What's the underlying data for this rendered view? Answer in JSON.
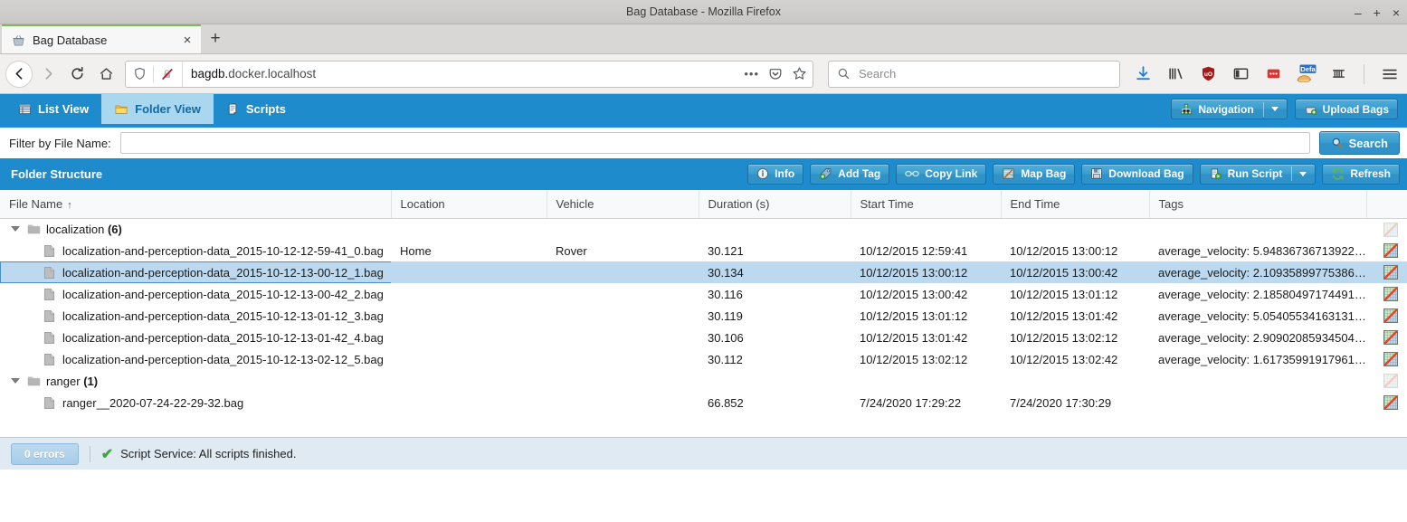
{
  "window": {
    "title": "Bag Database - Mozilla Firefox",
    "minimize": "–",
    "maximize": "+",
    "close": "×"
  },
  "browser": {
    "tab": {
      "title": "Bag Database",
      "favicon": "basket-icon",
      "close": "×"
    },
    "new_tab": "+",
    "nav": {
      "back": "←",
      "forward": "→",
      "reload": "⟳",
      "home": "⌂"
    },
    "url": {
      "host": "bagdb.",
      "rest": "docker.localhost",
      "full": "bagdb.docker.localhost"
    },
    "url_icons": {
      "more": "•••",
      "pocket": "pocket-icon",
      "bookmark": "☆"
    },
    "search": {
      "placeholder": "Search",
      "icon": "search-icon"
    },
    "toolbar_icons": [
      "download-icon",
      "library-icon",
      "ublock-origin-icon",
      "sidebar-icon",
      "red-dots-addon-icon",
      "default-profile-icon",
      "containers-icon",
      "hamburger-menu-icon"
    ],
    "ublock_label": "uO",
    "profile_badge": "Defa",
    "hamburger": "☰"
  },
  "app": {
    "tabs": [
      {
        "label": "List View",
        "icon": "table-icon",
        "active": false
      },
      {
        "label": "Folder View",
        "icon": "folder-icon",
        "active": true
      },
      {
        "label": "Scripts",
        "icon": "script-icon",
        "active": false
      }
    ],
    "toolbar_right": [
      {
        "label": "Navigation",
        "icon": "sitemap-icon",
        "has_caret": true
      },
      {
        "label": "Upload Bags",
        "icon": "upload-basket-icon",
        "has_caret": false
      }
    ],
    "filter": {
      "label": "Filter by File Name:",
      "value": "",
      "placeholder": "",
      "search_button": "Search",
      "search_icon": "magnifier-icon"
    },
    "panel": {
      "title": "Folder Structure",
      "buttons": [
        {
          "label": "Info",
          "icon": "info-icon",
          "has_caret": false
        },
        {
          "label": "Add Tag",
          "icon": "tag-add-icon",
          "has_caret": false
        },
        {
          "label": "Copy Link",
          "icon": "link-icon",
          "has_caret": false
        },
        {
          "label": "Map Bag",
          "icon": "map-icon",
          "has_caret": false
        },
        {
          "label": "Download Bag",
          "icon": "floppy-disk-icon",
          "has_caret": false
        },
        {
          "label": "Run Script",
          "icon": "run-script-icon",
          "has_caret": true
        },
        {
          "label": "Refresh",
          "icon": "refresh-icon",
          "has_caret": false
        }
      ]
    },
    "grid": {
      "columns": [
        {
          "key": "name",
          "label": "File Name",
          "sort": "↑"
        },
        {
          "key": "location",
          "label": "Location",
          "sort": ""
        },
        {
          "key": "vehicle",
          "label": "Vehicle",
          "sort": ""
        },
        {
          "key": "duration",
          "label": "Duration (s)",
          "sort": ""
        },
        {
          "key": "start",
          "label": "Start Time",
          "sort": ""
        },
        {
          "key": "end",
          "label": "End Time",
          "sort": ""
        },
        {
          "key": "tags",
          "label": "Tags",
          "sort": ""
        },
        {
          "key": "map",
          "label": "",
          "sort": ""
        }
      ],
      "rows": [
        {
          "type": "folder",
          "name": "localization",
          "count": "(6)",
          "location": "",
          "vehicle": "",
          "duration": "",
          "start": "",
          "end": "",
          "tags": "",
          "map_icon": "map-thumbnail-icon",
          "map_faded": true,
          "selected": false
        },
        {
          "type": "file",
          "name": "localization-and-perception-data_2015-10-12-12-59-41_0.bag",
          "location": "Home",
          "vehicle": "Rover",
          "duration": "30.121",
          "start": "10/12/2015 12:59:41",
          "end": "10/12/2015 13:00:12",
          "tags": "average_velocity: 5.94836736713922…",
          "map_icon": "map-thumbnail-icon",
          "map_faded": false,
          "selected": false
        },
        {
          "type": "file",
          "name": "localization-and-perception-data_2015-10-12-13-00-12_1.bag",
          "location": "",
          "vehicle": "",
          "duration": "30.134",
          "start": "10/12/2015 13:00:12",
          "end": "10/12/2015 13:00:42",
          "tags": "average_velocity: 2.10935899775386…",
          "map_icon": "map-thumbnail-icon",
          "map_faded": false,
          "selected": true
        },
        {
          "type": "file",
          "name": "localization-and-perception-data_2015-10-12-13-00-42_2.bag",
          "location": "",
          "vehicle": "",
          "duration": "30.116",
          "start": "10/12/2015 13:00:42",
          "end": "10/12/2015 13:01:12",
          "tags": "average_velocity: 2.18580497174491…",
          "map_icon": "map-thumbnail-icon",
          "map_faded": false,
          "selected": false
        },
        {
          "type": "file",
          "name": "localization-and-perception-data_2015-10-12-13-01-12_3.bag",
          "location": "",
          "vehicle": "",
          "duration": "30.119",
          "start": "10/12/2015 13:01:12",
          "end": "10/12/2015 13:01:42",
          "tags": "average_velocity: 5.05405534163131…",
          "map_icon": "map-thumbnail-icon",
          "map_faded": false,
          "selected": false
        },
        {
          "type": "file",
          "name": "localization-and-perception-data_2015-10-12-13-01-42_4.bag",
          "location": "",
          "vehicle": "",
          "duration": "30.106",
          "start": "10/12/2015 13:01:42",
          "end": "10/12/2015 13:02:12",
          "tags": "average_velocity: 2.90902085934504…",
          "map_icon": "map-thumbnail-icon",
          "map_faded": false,
          "selected": false
        },
        {
          "type": "file",
          "name": "localization-and-perception-data_2015-10-12-13-02-12_5.bag",
          "location": "",
          "vehicle": "",
          "duration": "30.112",
          "start": "10/12/2015 13:02:12",
          "end": "10/12/2015 13:02:42",
          "tags": "average_velocity: 1.61735991917961…",
          "map_icon": "map-thumbnail-icon",
          "map_faded": false,
          "selected": false
        },
        {
          "type": "folder",
          "name": "ranger",
          "count": "(1)",
          "location": "",
          "vehicle": "",
          "duration": "",
          "start": "",
          "end": "",
          "tags": "",
          "map_icon": "map-thumbnail-icon",
          "map_faded": true,
          "selected": false
        },
        {
          "type": "file",
          "name": "ranger__2020-07-24-22-29-32.bag",
          "location": "",
          "vehicle": "",
          "duration": "66.852",
          "start": "7/24/2020 17:29:22",
          "end": "7/24/2020 17:30:29",
          "tags": "",
          "map_icon": "map-thumbnail-icon",
          "map_faded": false,
          "selected": false
        }
      ]
    },
    "status": {
      "errors_badge": "0 errors",
      "message": "Script Service: All scripts finished.",
      "check_icon": "✔"
    }
  },
  "colors": {
    "app_blue": "#1e8bcd",
    "active_tab_bg": "#aad7f0",
    "selection_blue": "#bcd9ef",
    "status_bg": "#dfeaf3"
  }
}
